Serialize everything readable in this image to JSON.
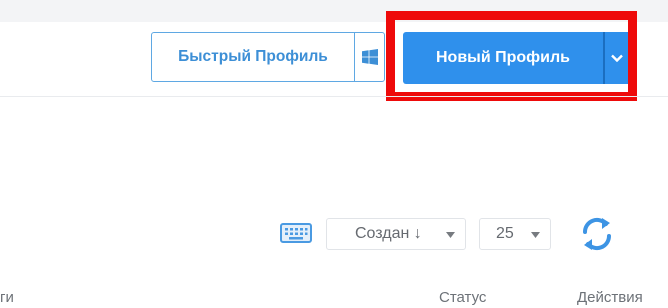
{
  "header": {
    "quick_profile_label": "Быстрый Профиль",
    "os_icon": "windows-icon",
    "new_profile_label": "Новый Профиль",
    "new_profile_caret_icon": "chevron-down-icon"
  },
  "highlight": {
    "color": "#ee0a0a"
  },
  "toolbar": {
    "keyboard_icon": "keyboard-icon",
    "sort_value": "Создан ↓",
    "page_size_value": "25",
    "refresh_icon": "refresh-icon"
  },
  "table": {
    "columns": [
      "ги",
      "Статус",
      "Действия"
    ]
  },
  "colors": {
    "primary": "#2f90ec",
    "outline_blue": "#3d8fd6",
    "highlight_red": "#ee0a0a"
  }
}
